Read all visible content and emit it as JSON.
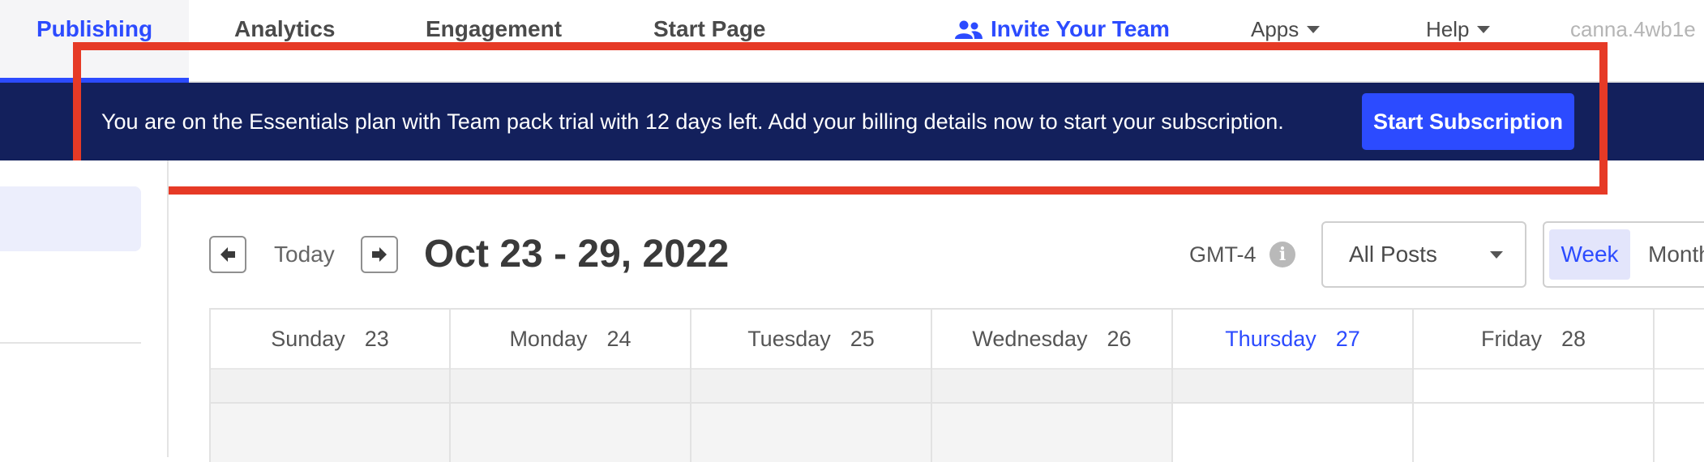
{
  "nav": {
    "tabs": [
      "Publishing",
      "Analytics",
      "Engagement",
      "Start Page"
    ],
    "invite": "Invite Your Team",
    "apps": "Apps",
    "help": "Help",
    "account": "canna.4wb1e"
  },
  "banner": {
    "message": "You are on the Essentials plan with Team pack trial with 12 days left. Add your billing details now to start your subscription.",
    "button": "Start Subscription"
  },
  "calendar": {
    "today_label": "Today",
    "range": "Oct 23 - 29, 2022",
    "timezone": "GMT-4",
    "filter": "All Posts",
    "views": [
      "Week",
      "Month"
    ],
    "days": [
      {
        "name": "Sunday",
        "num": "23"
      },
      {
        "name": "Monday",
        "num": "24"
      },
      {
        "name": "Tuesday",
        "num": "25"
      },
      {
        "name": "Wednesday",
        "num": "26"
      },
      {
        "name": "Thursday",
        "num": "27"
      },
      {
        "name": "Friday",
        "num": "28"
      }
    ]
  },
  "colors": {
    "accent": "#2c4bff",
    "banner": "#13205c",
    "highlight": "#e63a26"
  },
  "icons": [
    "users-icon",
    "chevron-down-icon",
    "arrow-left-icon",
    "arrow-right-icon",
    "info-icon"
  ]
}
